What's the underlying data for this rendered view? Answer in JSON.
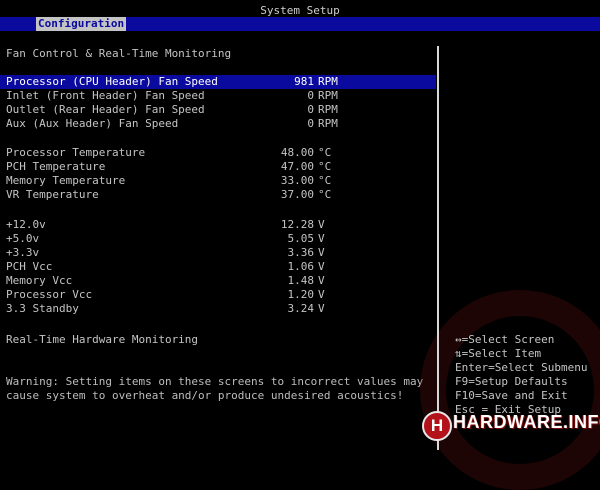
{
  "header": {
    "title": "System Setup",
    "active_tab": "Configuration"
  },
  "section_title": "Fan Control & Real-Time Monitoring",
  "fans": [
    {
      "label": "Processor (CPU Header) Fan Speed",
      "value": "981",
      "unit": "RPM",
      "selected": true
    },
    {
      "label": "Inlet (Front Header) Fan Speed",
      "value": "0",
      "unit": "RPM"
    },
    {
      "label": "Outlet (Rear Header) Fan Speed",
      "value": "0",
      "unit": "RPM"
    },
    {
      "label": "Aux (Aux Header) Fan Speed",
      "value": "0",
      "unit": "RPM"
    }
  ],
  "temperatures": [
    {
      "label": "Processor Temperature",
      "value": "48.00",
      "unit": "°C"
    },
    {
      "label": "PCH Temperature",
      "value": "47.00",
      "unit": "°C"
    },
    {
      "label": "Memory Temperature",
      "value": "33.00",
      "unit": "°C"
    },
    {
      "label": "VR Temperature",
      "value": "37.00",
      "unit": "°C"
    }
  ],
  "voltages": [
    {
      "label": "+12.0v",
      "value": "12.28",
      "unit": "V"
    },
    {
      "label": "+5.0v",
      "value": "5.05",
      "unit": "V"
    },
    {
      "label": "+3.3v",
      "value": "3.36",
      "unit": "V"
    },
    {
      "label": "PCH Vcc",
      "value": "1.06",
      "unit": "V"
    },
    {
      "label": "Memory Vcc",
      "value": "1.48",
      "unit": "V"
    },
    {
      "label": "Processor Vcc",
      "value": "1.20",
      "unit": "V"
    },
    {
      "label": "3.3 Standby",
      "value": "3.24",
      "unit": "V"
    }
  ],
  "realtime_label": "Real-Time Hardware Monitoring",
  "warning": "Warning: Setting items on these screens to incorrect values may cause system to overheat and/or produce undesired acoustics!",
  "help": [
    "↔=Select Screen",
    "⇅=Select Item",
    "Enter=Select Submenu",
    "F9=Setup Defaults",
    "F10=Save and Exit",
    "Esc = Exit Setup"
  ],
  "logo": {
    "text": "HARDWARE.INFO",
    "letter": "H"
  },
  "colors": {
    "background": "#000000",
    "highlight": "#0a0a9e",
    "text": "#c4c4c4",
    "logo_red": "#b3121a"
  }
}
